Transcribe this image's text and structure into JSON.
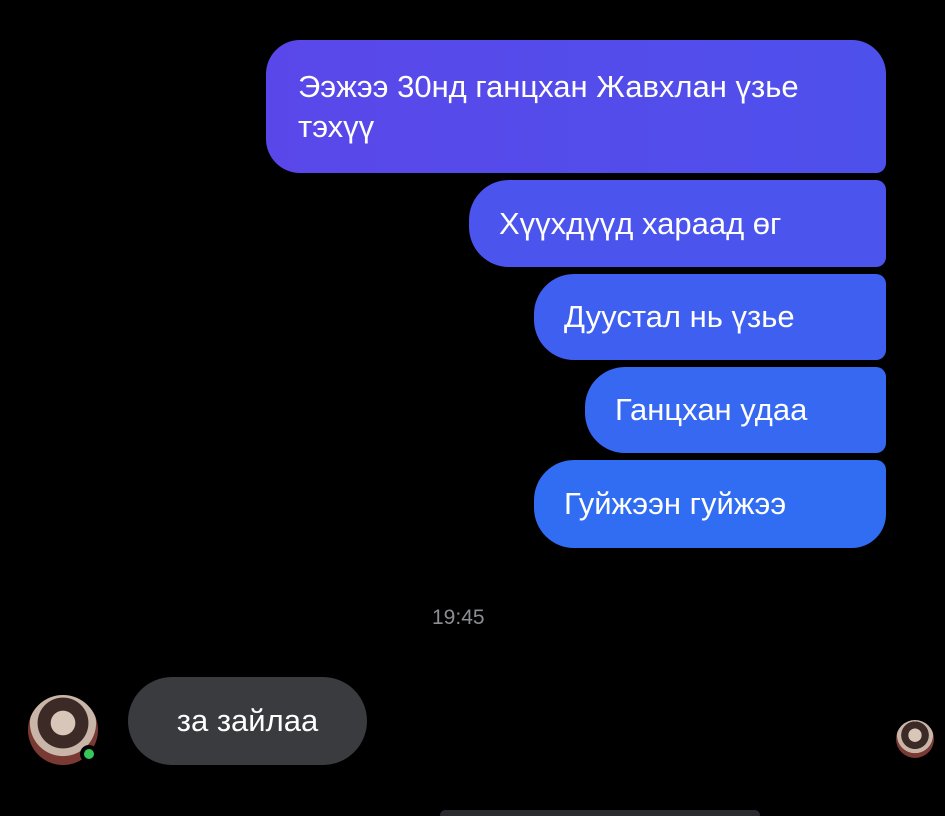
{
  "conversation": {
    "outgoing": [
      {
        "text": "Ээжээ 30нд ганцхан Жавхлан үзье тэхүү"
      },
      {
        "text": "Хүүхдүүд хараад өг"
      },
      {
        "text": "Дуустал нь үзье"
      },
      {
        "text": "Ганцхан удаа"
      },
      {
        "text": "Гуйжээн гуйжээ"
      }
    ],
    "timestamp": "19:45",
    "incoming": [
      {
        "text": "за зайлаа"
      }
    ]
  },
  "colors": {
    "background": "#000000",
    "outgoing_gradient_top": "#5a47ea",
    "outgoing_gradient_bottom": "#306df3",
    "incoming_bubble": "#3a3b3f",
    "online_indicator": "#35c759",
    "timestamp_text": "#8b8d93"
  },
  "icons": {
    "contact_avatar": "avatar",
    "online_status": "online-dot-icon",
    "read_receipt": "seen-avatar"
  }
}
